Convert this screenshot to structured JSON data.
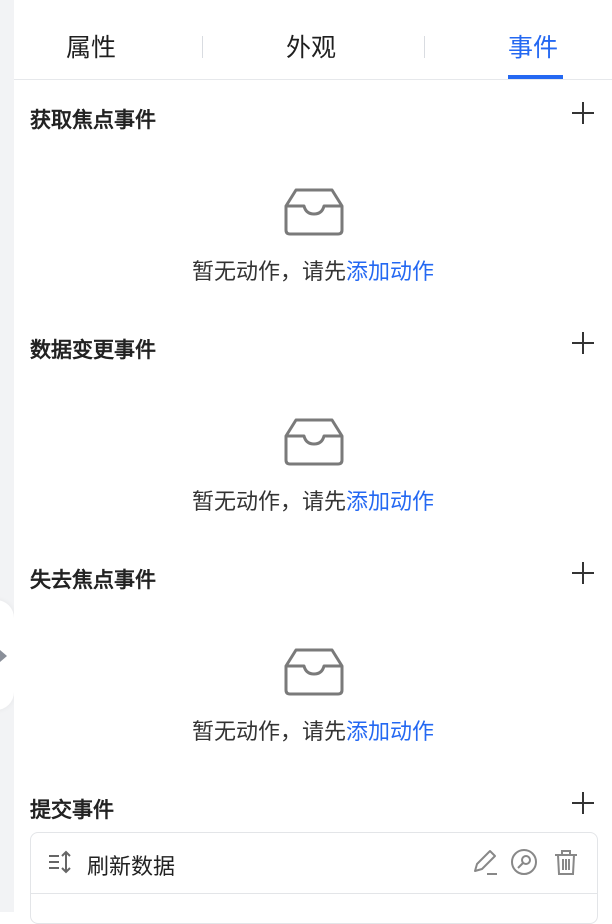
{
  "tabs": [
    {
      "label": "属性",
      "active": false
    },
    {
      "label": "外观",
      "active": false
    },
    {
      "label": "事件",
      "active": true
    }
  ],
  "sections": [
    {
      "title": "获取焦点事件",
      "empty_text": "暂无动作，请先",
      "empty_link": "添加动作"
    },
    {
      "title": "数据变更事件",
      "empty_text": "暂无动作，请先",
      "empty_link": "添加动作"
    },
    {
      "title": "失去焦点事件",
      "empty_text": "暂无动作，请先",
      "empty_link": "添加动作"
    },
    {
      "title": "提交事件",
      "actions": [
        {
          "label": "刷新数据",
          "icons": [
            "sort-icon",
            "edit-icon",
            "search-icon",
            "trash-icon"
          ]
        }
      ]
    }
  ],
  "colors": {
    "accent": "#2468f2",
    "text": "#222222",
    "border": "#e3e5e8"
  },
  "icons": {
    "add": "plus-icon",
    "empty": "inbox-empty-icon",
    "collapse": "caret-right-icon"
  }
}
